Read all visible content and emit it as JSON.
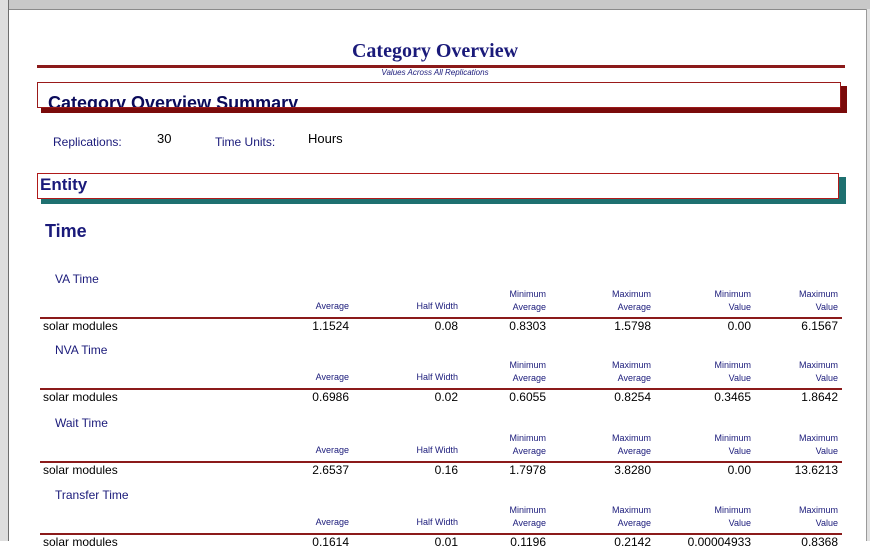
{
  "report": {
    "title": "Category Overview",
    "subtitle": "Values Across All Replications",
    "banner_text": "Category Overview Summary"
  },
  "meta": {
    "replications_label": "Replications:",
    "replications_value": "30",
    "time_units_label": "Time Units:",
    "time_units_value": "Hours"
  },
  "section": {
    "label": "Entity"
  },
  "subsection": {
    "label": "Time"
  },
  "columns": {
    "average": "Average",
    "half_width": "Half Width",
    "minimum": "Minimum",
    "maximum": "Maximum",
    "value": "Value"
  },
  "stats": [
    {
      "title": "VA Time",
      "row_label": "solar modules",
      "values": [
        "1.1524",
        "0.08",
        "0.8303",
        "1.5798",
        "0.00",
        "6.1567"
      ]
    },
    {
      "title": "NVA Time",
      "row_label": "solar modules",
      "values": [
        "0.6986",
        "0.02",
        "0.6055",
        "0.8254",
        "0.3465",
        "1.8642"
      ]
    },
    {
      "title": "Wait Time",
      "row_label": "solar modules",
      "values": [
        "2.6537",
        "0.16",
        "1.7978",
        "3.8280",
        "0.00",
        "13.6213"
      ]
    },
    {
      "title": "Transfer Time",
      "row_label": "solar modules",
      "values": [
        "0.1614",
        "0.01",
        "0.1196",
        "0.2142",
        "0.00004933",
        "0.8368"
      ]
    }
  ]
}
